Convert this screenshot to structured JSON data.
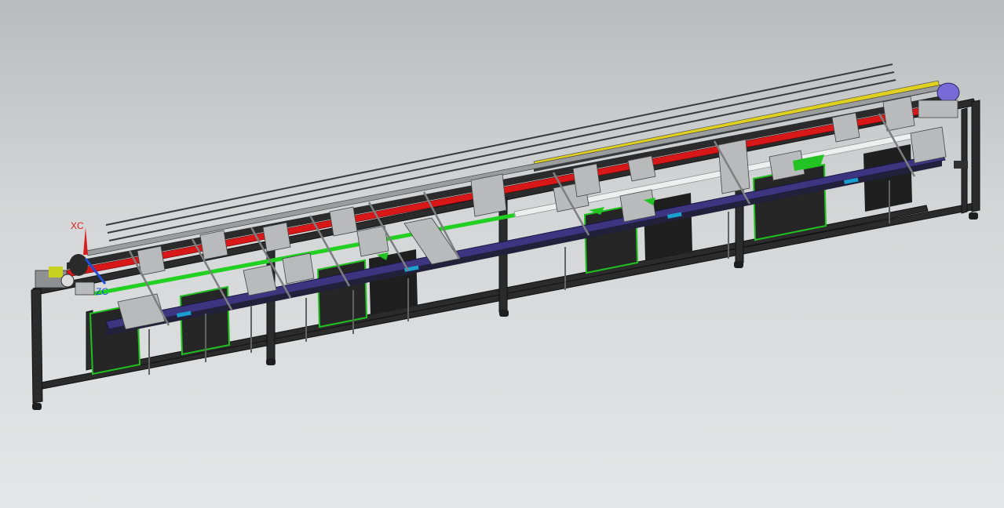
{
  "viewport": {
    "background_top": "#b9bbbd",
    "background_bottom": "#e4e6e7"
  },
  "axis_triad": {
    "x_label": "XC",
    "z_label": "ZC",
    "x_color": "#d81e1e",
    "z_color": "#1f4fd6"
  },
  "model": {
    "frame_color": "#2a2a2a",
    "rail_red": "#d81818",
    "rail_green": "#22d022",
    "rail_yellow": "#e0d020",
    "belt_purple": "#3d3580",
    "pad_cyan": "#1aa0d0",
    "part_grey": "#b8babc",
    "pulley_purple": "#7a6ad8"
  }
}
